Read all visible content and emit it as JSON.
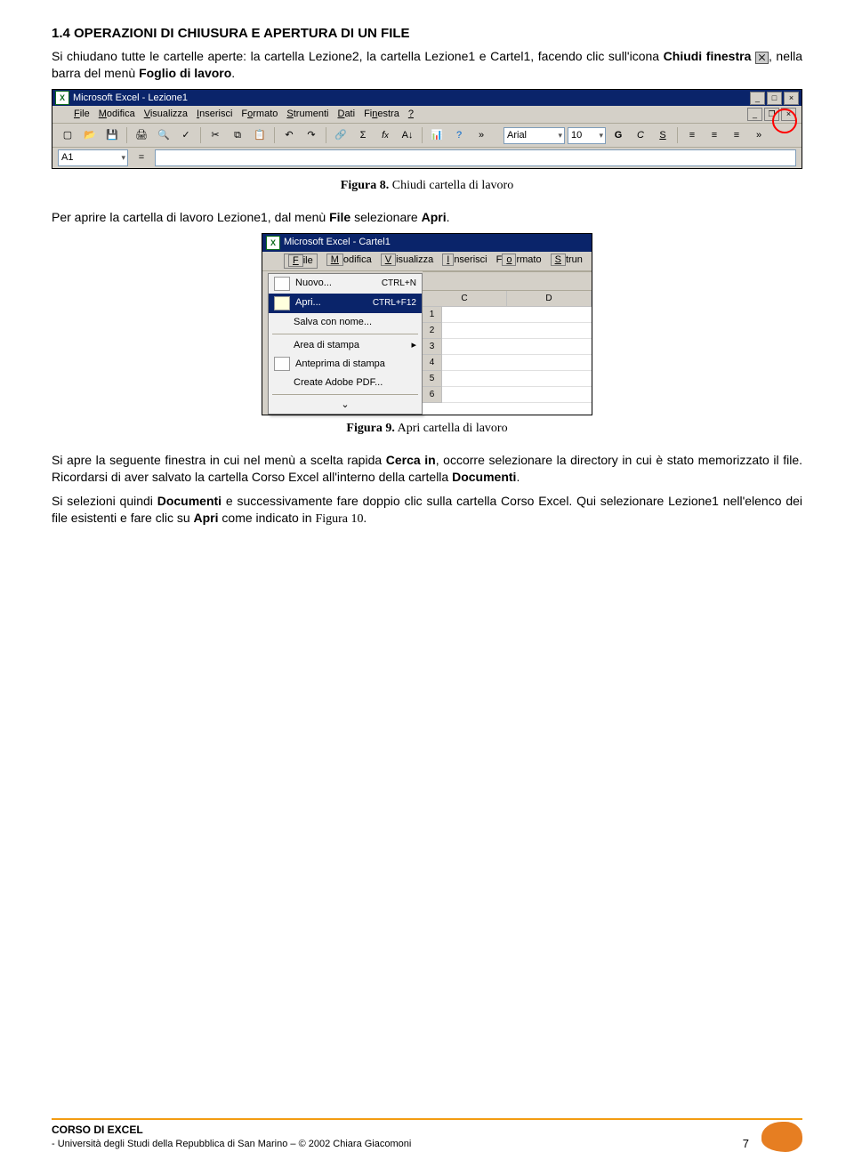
{
  "section": {
    "title": "1.4 OPERAZIONI DI CHIUSURA E APERTURA DI UN FILE",
    "p1a": "Si chiudano tutte le cartelle aperte: la cartella Lezione2, la cartella Lezione1 e Cartel1, facendo clic sull'icona ",
    "p1b": "Chiudi finestra",
    "p1c": ", nella barra del menù ",
    "p1d": "Foglio di lavoro",
    "p1e": "."
  },
  "fig8": {
    "title": "Microsoft Excel - Lezione1",
    "menus": [
      "File",
      "Modifica",
      "Visualizza",
      "Inserisci",
      "Formato",
      "Strumenti",
      "Dati",
      "Finestra",
      "?"
    ],
    "font": "Arial",
    "size": "10",
    "namebox": "A1",
    "caption_b": "Figura 8.",
    "caption_t": " Chiudi cartella di lavoro"
  },
  "para2a": "Per aprire la cartella di lavoro Lezione1, dal menù ",
  "para2b": "File",
  "para2c": " selezionare ",
  "para2d": "Apri",
  "para2e": ".",
  "fig9": {
    "title": "Microsoft Excel - Cartel1",
    "menus": [
      "File",
      "Modifica",
      "Visualizza",
      "Inserisci",
      "Formato",
      "Strum"
    ],
    "items": [
      {
        "label": "Nuovo...",
        "sc": "CTRL+N",
        "icon": true
      },
      {
        "label": "Apri...",
        "sc": "CTRL+F12",
        "icon": true,
        "sel": true
      },
      {
        "label": "Salva con nome...",
        "sc": "",
        "sep_after": true
      },
      {
        "label": "Area di stampa",
        "arr": true
      },
      {
        "label": "Anteprima di stampa",
        "icon": true
      },
      {
        "label": "Create Adobe PDF...",
        "sep_after": true
      }
    ],
    "expand": "⌄",
    "cols": [
      "C",
      "D"
    ],
    "rows": [
      "1",
      "2",
      "3",
      "4",
      "5",
      "6"
    ],
    "caption_b": "Figura 9.",
    "caption_t": " Apri cartella di lavoro"
  },
  "para3": {
    "t1": "Si apre la seguente finestra in cui nel menù a scelta rapida ",
    "b1": "Cerca in",
    "t2": ", occorre selezionare la directory in cui è stato memorizzato il file. Ricordarsi di aver salvato la cartella Corso Excel all'interno della cartella ",
    "b2": "Documenti",
    "t3": "."
  },
  "para4": {
    "t1": "Si selezioni quindi ",
    "b1": "Documenti",
    "t2": " e successivamente fare doppio clic sulla cartella Corso Excel. Qui selezionare Lezione1 nell'elenco dei file esistenti e fare clic su ",
    "b2": "Apri",
    "t3": " come indicato in ",
    "fig": "Figura 10.",
    "t4": ""
  },
  "footer": {
    "title": "CORSO DI EXCEL",
    "sub": "- Università degli Studi della Repubblica di San Marino –  © 2002 Chiara Giacomoni",
    "page": "7"
  }
}
